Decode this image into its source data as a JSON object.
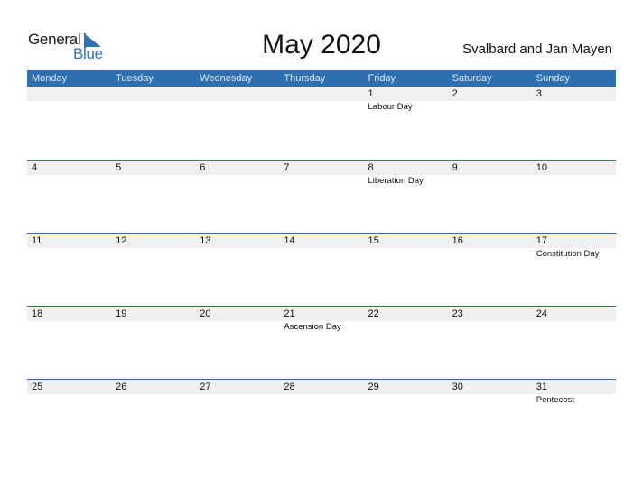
{
  "logo": {
    "word1": "General",
    "word2": "Blue"
  },
  "title": "May 2020",
  "region": "Svalbard and Jan Mayen",
  "colors": {
    "header": "#2e6fb0",
    "date_row": "#f0f0f0",
    "brand_blue": "#2e74b5"
  },
  "weekdays": [
    "Monday",
    "Tuesday",
    "Wednesday",
    "Thursday",
    "Friday",
    "Saturday",
    "Sunday"
  ],
  "weeks": [
    {
      "days": [
        "",
        "",
        "",
        "",
        "1",
        "2",
        "3"
      ],
      "events": [
        "",
        "",
        "",
        "",
        "Labour Day",
        "",
        ""
      ]
    },
    {
      "days": [
        "4",
        "5",
        "6",
        "7",
        "8",
        "9",
        "10"
      ],
      "events": [
        "",
        "",
        "",
        "",
        "Liberation Day",
        "",
        ""
      ]
    },
    {
      "days": [
        "11",
        "12",
        "13",
        "14",
        "15",
        "16",
        "17"
      ],
      "events": [
        "",
        "",
        "",
        "",
        "",
        "",
        "Constitution Day"
      ]
    },
    {
      "days": [
        "18",
        "19",
        "20",
        "21",
        "22",
        "23",
        "24"
      ],
      "events": [
        "",
        "",
        "",
        "Ascension Day",
        "",
        "",
        ""
      ]
    },
    {
      "days": [
        "25",
        "26",
        "27",
        "28",
        "29",
        "30",
        "31"
      ],
      "events": [
        "",
        "",
        "",
        "",
        "",
        "",
        "Pentecost"
      ]
    }
  ]
}
